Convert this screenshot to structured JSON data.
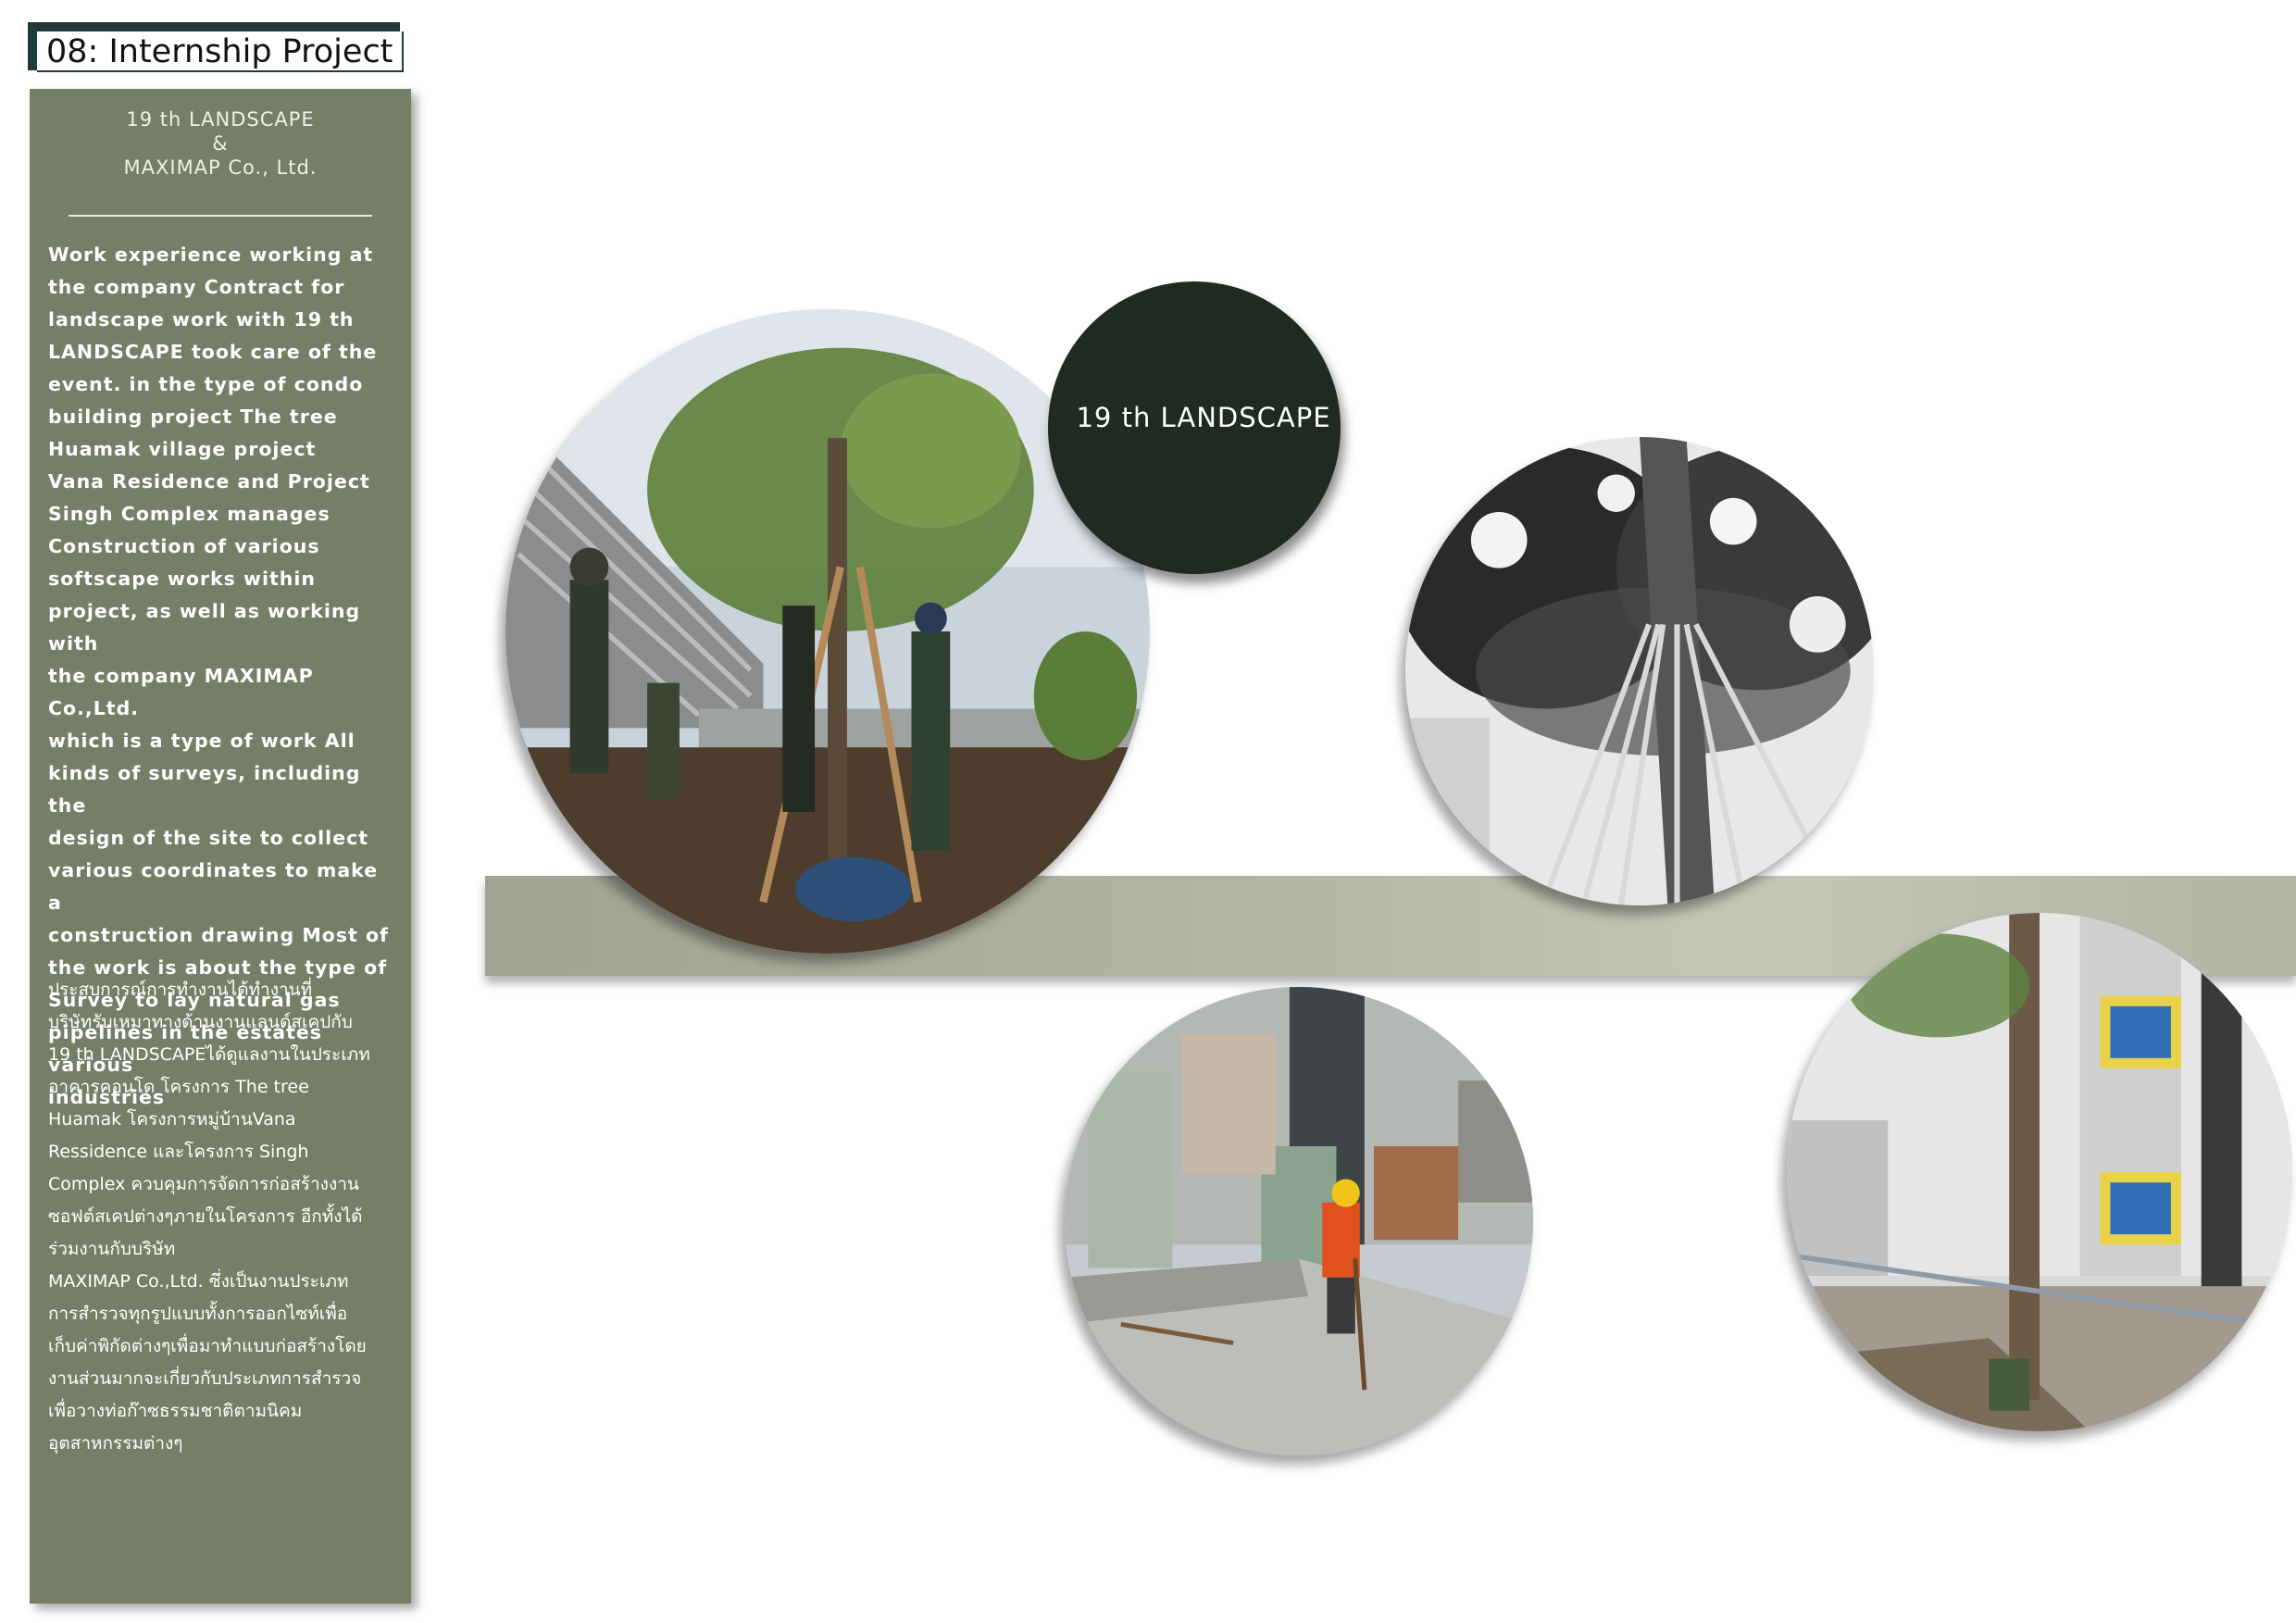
{
  "header": {
    "title": "08: Internship Project"
  },
  "sidebar": {
    "company_line1": "19 th LANDSCAPE",
    "company_line2": "&",
    "company_line3": "MAXIMAP Co., Ltd.",
    "english_paragraph": "  Work experience working at\nthe company Contract for\nlandscape work with 19 th\nLANDSCAPE took care of the\nevent. in the type of condo\nbuilding project The tree\nHuamak village project\nVana Residence and Project\nSingh Complex manages\nConstruction of various\nsoftscape works within\nproject, as well as working with\nthe company MAXIMAP Co.,Ltd.\nwhich is a type of work All\nkinds of surveys, including the\ndesign of the site to collect\nvarious coordinates to make a\nconstruction drawing Most of\nthe work is about the type of\nSurvey to lay natural gas\npipelines in the estates various\nindustries",
    "thai_paragraph": "  ประสบการณ์การทำงานได้ทำงานที่\nบริษัทรับเหมาทางด้านงานแลนด์สเคปกับ\n19 th LANDSCAPEได้ดูแลงานในประเภท\nอาคารคอนโด โครงการ The tree\nHuamak โครงการหมู่บ้านVana\nRessidence และโครงการ Singh\nComplex ควบคุมการจัดการก่อสร้างงาน\nซอฟต์สเคปต่างๆภายในโครงการ อีกทั้งได้\nร่วมงานกับบริษัท\nMAXIMAP Co.,Ltd. ซึ่งเป็นงานประเภท\nการสำรวจทุกรูปแบบทั้งการออกไซท์เพื่อ\nเก็บค่าพิกัดต่างๆเพื่อมาทำแบบก่อสร้างโดย\nงานส่วนมากจะเกี่ยวกับประเภทการสำรวจ\nเพื่อวางท่อก๊าซธรรมชาติตามนิคม\nอุตสาหกรรมต่างๆ"
  },
  "badge": {
    "label": "19 th LANDSCAPE",
    "color": "#1f2a20"
  },
  "colors": {
    "sidebar": "#757e67",
    "band": "#b1b3a3",
    "title_accent": "#1f3a3a"
  }
}
